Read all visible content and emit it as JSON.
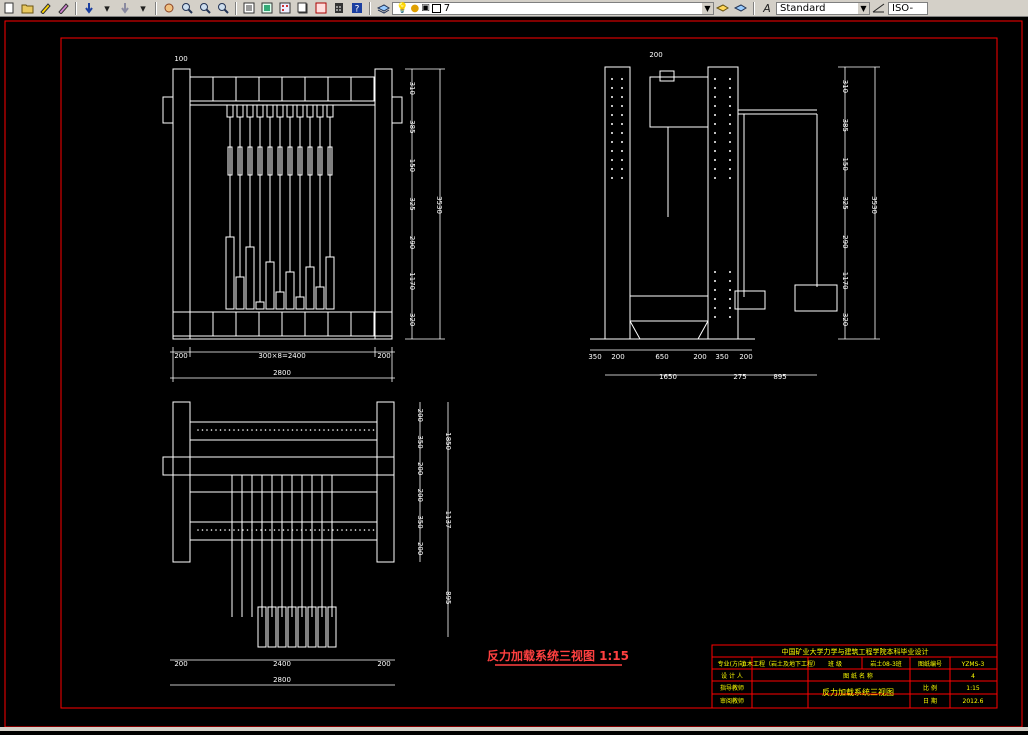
{
  "toolbar": {
    "layer_value": "7",
    "style_value": "Standard",
    "dim_style_value": "ISO-",
    "icons": [
      "new-icon",
      "open-icon",
      "pen-icon",
      "match-prop-icon",
      "undo-icon",
      "redo-icon",
      "pan-icon",
      "zoom-realtime-icon",
      "zoom-window-icon",
      "zoom-previous-icon",
      "properties-icon",
      "design-center-icon",
      "tool-palettes-icon",
      "sheet-set-icon",
      "markup-icon",
      "calculator-icon",
      "help-icon",
      "layer-manager-icon",
      "bulb-icon",
      "sun-icon",
      "lock-icon",
      "color-icon",
      "layer-previous-icon",
      "layer-state-icon",
      "text-style-icon",
      "dim-style-icon"
    ]
  },
  "drawing": {
    "front_view": {
      "dim_top": "100",
      "dim_bottom_left": "200",
      "dim_bottom_mid": "300×8=2400",
      "dim_bottom_right": "200",
      "dim_total": "2800",
      "dim_right_segments": [
        "310",
        "385",
        "150",
        "325",
        "290",
        "1170",
        "320"
      ],
      "dim_right_total": "3530"
    },
    "side_view": {
      "dim_top": "200",
      "dim_bottom_segments": [
        "350",
        "200",
        "650",
        "200",
        "350",
        "200"
      ],
      "dim_total_left": "1650",
      "dim_mid": "275",
      "dim_total_right": "895",
      "dim_right_segments": [
        "310",
        "385",
        "150",
        "325",
        "290",
        "1170",
        "320"
      ],
      "dim_right_total": "3530"
    },
    "plan_view": {
      "dim_bottom_left": "200",
      "dim_bottom_mid": "2400",
      "dim_bottom_right": "200",
      "dim_total": "2800",
      "dim_right_segments": [
        "200",
        "350",
        "200",
        "200",
        "350",
        "200"
      ],
      "dim_right_labels": [
        "1850",
        "1137",
        "895"
      ]
    },
    "drawing_title": "反力加载系统三视图 1:15"
  },
  "title_block": {
    "university": "中国矿业大学力学与建筑工程学院本科毕业设计",
    "row1": [
      "专业(方向)",
      "土木工程（岩土及地下工程）",
      "班 级",
      "岩土08-3班",
      "图纸编号",
      "YZMS-3"
    ],
    "row2": [
      "设 计 人",
      "",
      "图 纸 名 称",
      "",
      "",
      "4"
    ],
    "row3": [
      "指导教师",
      "",
      "反力加载系统三视图",
      "",
      "比 例",
      "1:15"
    ],
    "row4": [
      "审阅教师",
      "",
      "",
      "",
      "日 期",
      "2012.6"
    ],
    "colors": {
      "frame": "#ff0000",
      "text": "#ffff00",
      "title": "#ff4040"
    }
  }
}
